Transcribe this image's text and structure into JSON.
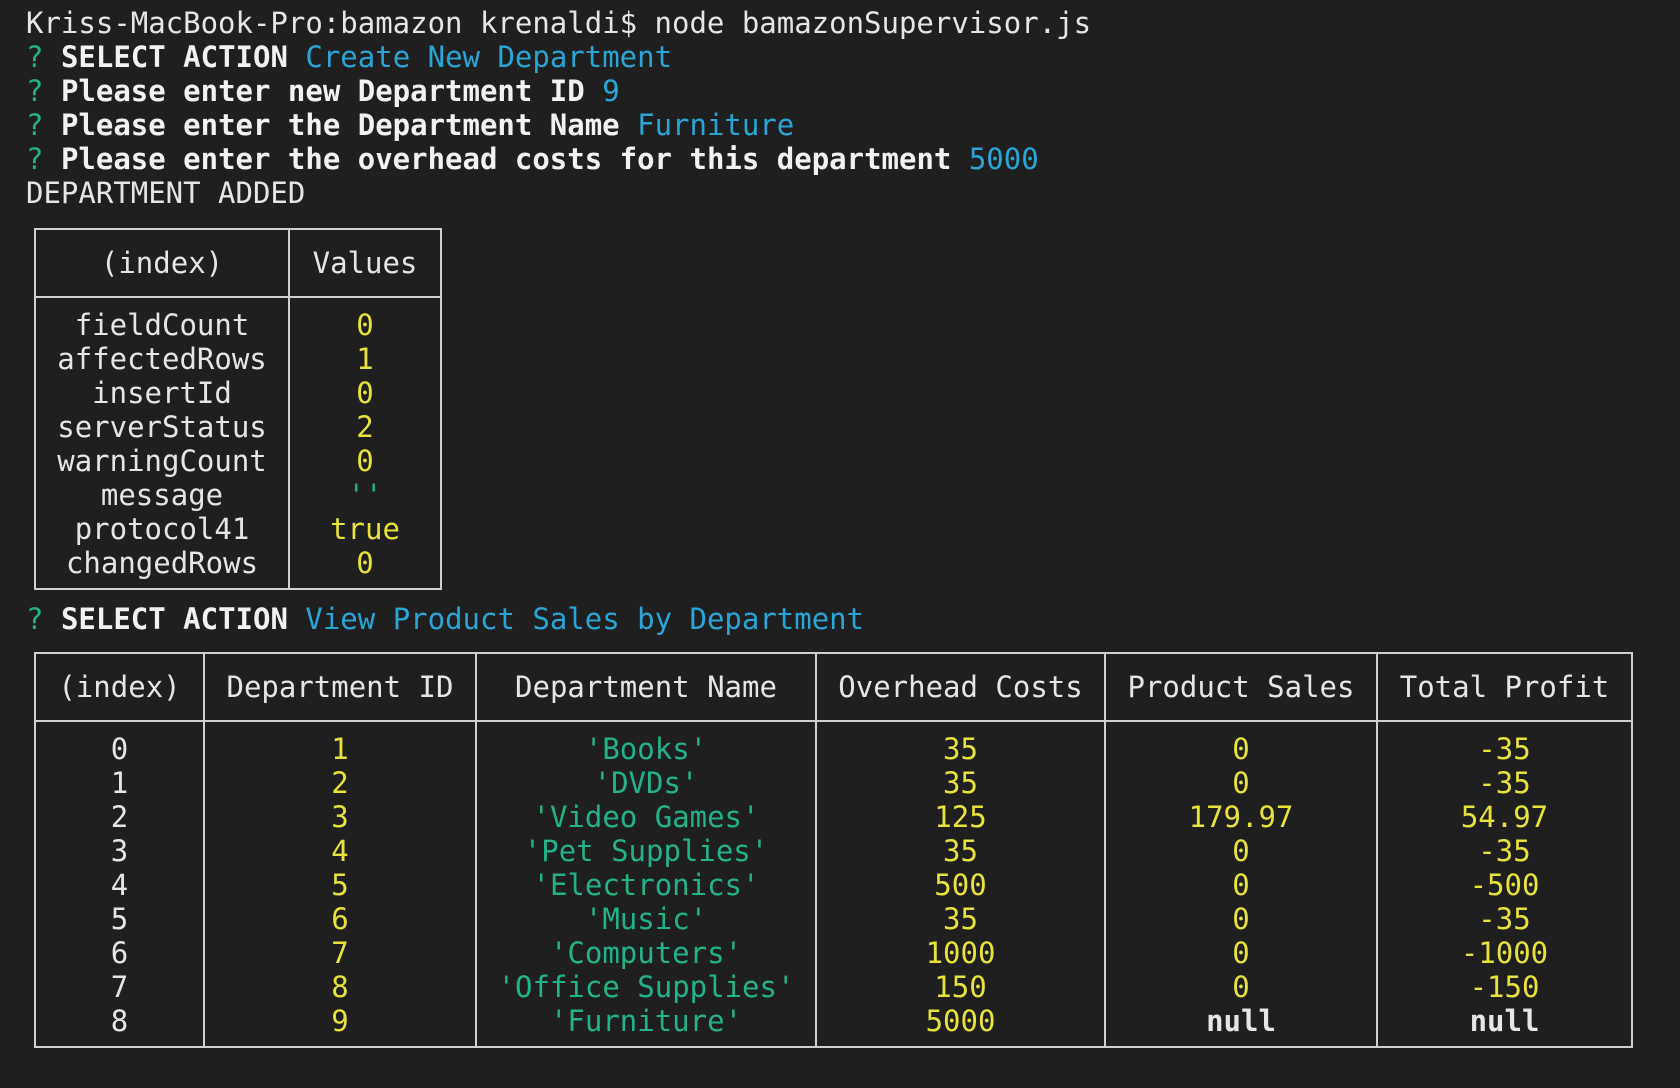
{
  "terminal": {
    "command_line": "Kriss-MacBook-Pro:bamazon krenaldi$ node bamazonSupervisor.js",
    "prompt_marker": "?",
    "prompts": [
      {
        "question": "SELECT ACTION",
        "answer": "Create New Department"
      },
      {
        "question": "Please enter new Department ID",
        "answer": "9"
      },
      {
        "question": "Please enter the Department Name",
        "answer": "Furniture"
      },
      {
        "question": "Please enter the overhead costs for this department",
        "answer": "5000"
      }
    ],
    "status_message": "DEPARTMENT ADDED",
    "second_prompt": {
      "question": "SELECT ACTION",
      "answer": "View Product Sales by Department"
    }
  },
  "result_table": {
    "headers": [
      "(index)",
      "Values"
    ],
    "rows": [
      [
        "fieldCount",
        "0"
      ],
      [
        "affectedRows",
        "1"
      ],
      [
        "insertId",
        "0"
      ],
      [
        "serverStatus",
        "2"
      ],
      [
        "warningCount",
        "0"
      ],
      [
        "message",
        "''"
      ],
      [
        "protocol41",
        "true"
      ],
      [
        "changedRows",
        "0"
      ]
    ]
  },
  "sales_table": {
    "headers": [
      "(index)",
      "Department ID",
      "Department Name",
      "Overhead Costs",
      "Product Sales",
      "Total Profit"
    ],
    "rows": [
      [
        "0",
        "1",
        "'Books'",
        "35",
        "0",
        "-35"
      ],
      [
        "1",
        "2",
        "'DVDs'",
        "35",
        "0",
        "-35"
      ],
      [
        "2",
        "3",
        "'Video Games'",
        "125",
        "179.97",
        "54.97"
      ],
      [
        "3",
        "4",
        "'Pet Supplies'",
        "35",
        "0",
        "-35"
      ],
      [
        "4",
        "5",
        "'Electronics'",
        "500",
        "0",
        "-500"
      ],
      [
        "5",
        "6",
        "'Music'",
        "35",
        "0",
        "-35"
      ],
      [
        "6",
        "7",
        "'Computers'",
        "1000",
        "0",
        "-1000"
      ],
      [
        "7",
        "8",
        "'Office Supplies'",
        "150",
        "0",
        "-150"
      ],
      [
        "8",
        "9",
        "'Furniture'",
        "5000",
        "null",
        "null"
      ]
    ]
  },
  "colors": {
    "background": "#1f1f1f",
    "prompt": "#22b38a",
    "answer": "#2aa6d6",
    "number": "#e8e33a",
    "string": "#22b38a",
    "text": "#e6e6e6"
  }
}
